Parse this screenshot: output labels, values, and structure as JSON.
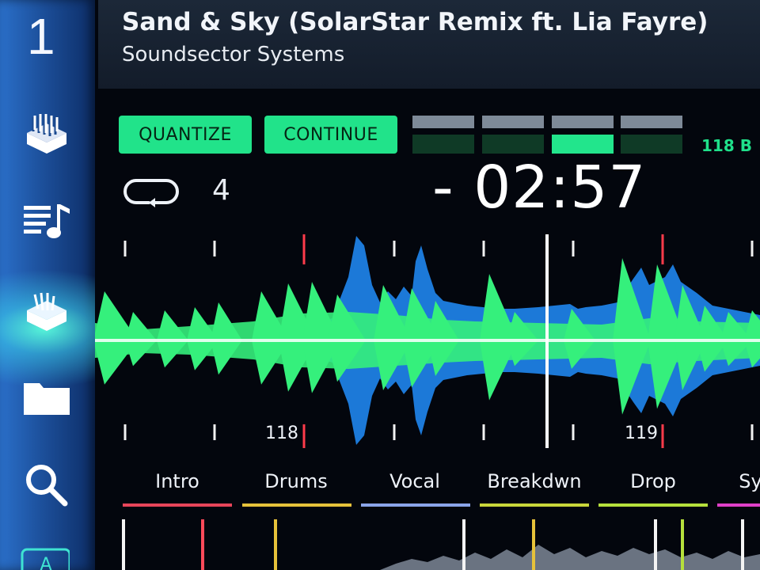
{
  "deck": {
    "number": "1"
  },
  "track": {
    "title": "Sand & Sky (SolarStar Remix ft. Lia Fayre)",
    "artist": "Soundsector Systems"
  },
  "controls": {
    "quantize_label": "QUANTIZE",
    "continue_label": "CONTINUE",
    "bpm_label": "118 B",
    "loop_count": "4",
    "time_remaining": "- 02:57",
    "beat_indicator": {
      "beats": 4,
      "active_beat": 3
    }
  },
  "sidebar": {
    "icons": [
      "deck-stack-icon",
      "playlist-icon",
      "deck-stack-active-icon",
      "folder-icon",
      "search-icon",
      "partial-bottom-icon"
    ]
  },
  "waveform": {
    "bar_markers": [
      "118",
      "119"
    ]
  },
  "sections": [
    {
      "label": "Intro",
      "color": "#e8455a"
    },
    {
      "label": "Drums",
      "color": "#e6c23a"
    },
    {
      "label": "Vocal",
      "color": "#8aa4e8"
    },
    {
      "label": "Breakdwn",
      "color": "#c9d63a"
    },
    {
      "label": "Drop",
      "color": "#b6e03c"
    },
    {
      "label": "Sy",
      "color": "#e040c8"
    }
  ],
  "colors": {
    "accent_green": "#21e38a",
    "waveform_green": "#35f07c",
    "waveform_blue": "#1f86ee",
    "cue_red": "#ff3b4a"
  }
}
